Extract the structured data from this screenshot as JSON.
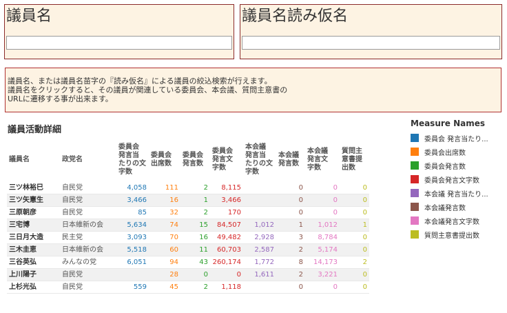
{
  "filters": {
    "name_title": "議員名",
    "name_value": "",
    "kana_title": "議員名読み仮名",
    "kana_value": ""
  },
  "info": {
    "lines": [
      "議員名、または議員名苗字の『読み仮名』による議員の絞込検索が行えます。",
      "議員名をクリックすると、その議員が関連している委員会、本会議、質問主意書の",
      "URLに遷移する事が出来ます。"
    ]
  },
  "detail": {
    "title": "議員活動詳細",
    "columns": [
      {
        "label": "議員名",
        "lines": [
          "議員名"
        ]
      },
      {
        "label": "政党名",
        "lines": [
          "政党名"
        ]
      },
      {
        "label": "委員会発言当たりの文字数",
        "lines": [
          "委員会",
          "発言当",
          "たりの文",
          "字数"
        ]
      },
      {
        "label": "委員会出席数",
        "lines": [
          "委員会",
          "出席数"
        ]
      },
      {
        "label": "委員会発言数",
        "lines": [
          "委員会",
          "発言数"
        ]
      },
      {
        "label": "委員会発言文字数",
        "lines": [
          "委員会",
          "発言文",
          "字数"
        ]
      },
      {
        "label": "本会議発言当たりの文字数",
        "lines": [
          "本会議",
          "発言当",
          "たりの文",
          "字数"
        ]
      },
      {
        "label": "本会議発言数",
        "lines": [
          "本会議",
          "発言数"
        ]
      },
      {
        "label": "本会議発言文字数",
        "lines": [
          "本会議",
          "発言文",
          "字数"
        ]
      },
      {
        "label": "質問主意書提出数",
        "lines": [
          "質問主",
          "意書提",
          "出数"
        ]
      }
    ],
    "rows": [
      {
        "name": "三ツ林裕巳",
        "party": "自民党",
        "c1": "4,058",
        "c2": "111",
        "c3": "2",
        "c4": "8,115",
        "c5": "",
        "c6": "0",
        "c7": "0",
        "c8": "0"
      },
      {
        "name": "三ツ矢憲生",
        "party": "自民党",
        "c1": "3,466",
        "c2": "16",
        "c3": "1",
        "c4": "3,466",
        "c5": "",
        "c6": "0",
        "c7": "0",
        "c8": "0"
      },
      {
        "name": "三原朝彦",
        "party": "自民党",
        "c1": "85",
        "c2": "32",
        "c3": "2",
        "c4": "170",
        "c5": "",
        "c6": "0",
        "c7": "0",
        "c8": "0"
      },
      {
        "name": "三宅博",
        "party": "日本維新の会",
        "c1": "5,634",
        "c2": "74",
        "c3": "15",
        "c4": "84,507",
        "c5": "1,012",
        "c6": "1",
        "c7": "1,012",
        "c8": "1"
      },
      {
        "name": "三日月大造",
        "party": "民主党",
        "c1": "3,093",
        "c2": "70",
        "c3": "16",
        "c4": "49,482",
        "c5": "2,928",
        "c6": "3",
        "c7": "8,784",
        "c8": "0"
      },
      {
        "name": "三木圭恵",
        "party": "日本維新の会",
        "c1": "5,518",
        "c2": "60",
        "c3": "11",
        "c4": "60,703",
        "c5": "2,587",
        "c6": "2",
        "c7": "5,174",
        "c8": "0"
      },
      {
        "name": "三谷英弘",
        "party": "みんなの党",
        "c1": "6,051",
        "c2": "94",
        "c3": "43",
        "c4": "260,174",
        "c5": "1,772",
        "c6": "8",
        "c7": "14,173",
        "c8": "2"
      },
      {
        "name": "上川陽子",
        "party": "自民党",
        "c1": "",
        "c2": "28",
        "c3": "0",
        "c4": "0",
        "c5": "1,611",
        "c6": "2",
        "c7": "3,221",
        "c8": "0"
      },
      {
        "name": "上杉光弘",
        "party": "自民党",
        "c1": "559",
        "c2": "45",
        "c3": "2",
        "c4": "1,118",
        "c5": "",
        "c6": "0",
        "c7": "0",
        "c8": "0"
      }
    ]
  },
  "legend": {
    "title": "Measure Names",
    "items": [
      {
        "label": "委員会 発言当たり...",
        "color": "#1f77b4"
      },
      {
        "label": "委員会出席数",
        "color": "#ff7f0e"
      },
      {
        "label": "委員会発言数",
        "color": "#2ca02c"
      },
      {
        "label": "委員会発言文字数",
        "color": "#d62728"
      },
      {
        "label": "本会議 発言当たり...",
        "color": "#9467bd"
      },
      {
        "label": "本会議発言数",
        "color": "#8c564b"
      },
      {
        "label": "本会議発言文字数",
        "color": "#e377c2"
      },
      {
        "label": "質問主意書提出数",
        "color": "#bcbd22"
      }
    ]
  }
}
